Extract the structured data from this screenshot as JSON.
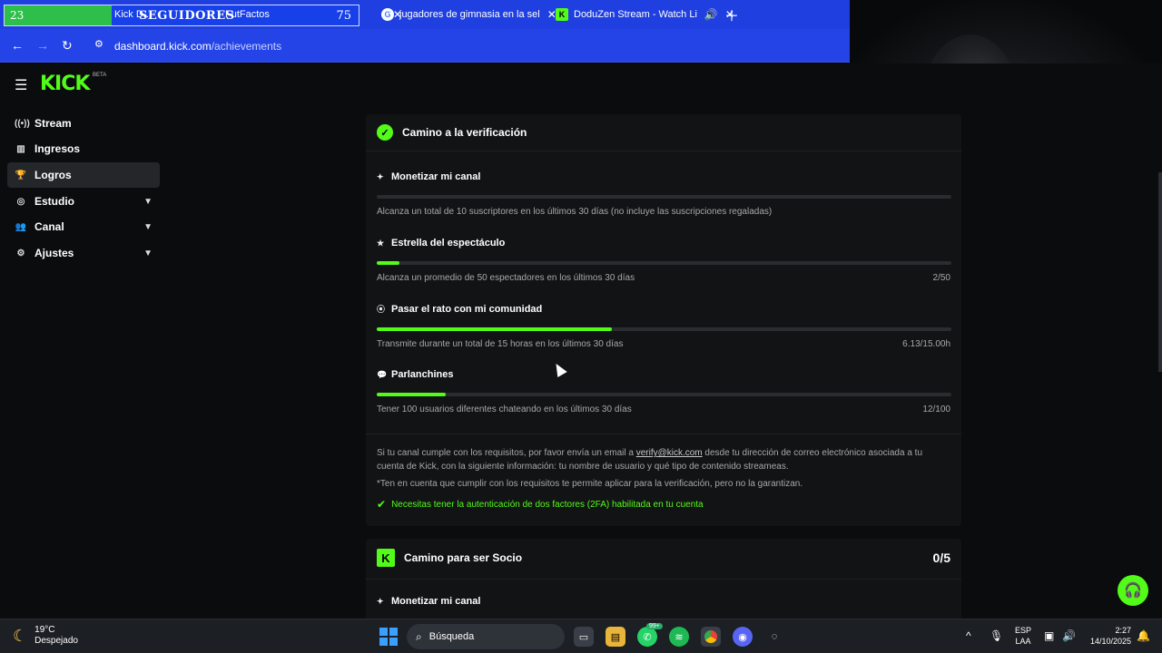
{
  "browser": {
    "overlay": {
      "left_value": "23",
      "title": "SEGUIDORES",
      "right_value": "75"
    },
    "tabs": [
      {
        "label": "Kick D...",
        "icon": "kick-icon"
      },
      {
        "label": "FutFactos",
        "icon": "page-icon"
      },
      {
        "label": "jugadores de gimnasia en la sel",
        "icon": "google-icon"
      },
      {
        "label": "DoduZen Stream - Watch Li",
        "icon": "kick-icon"
      }
    ],
    "url_host": "dashboard.kick.com",
    "url_path": "/achievements"
  },
  "app": {
    "logo": "KICK",
    "logo_badge": "BETA",
    "nav": [
      {
        "label": "Stream",
        "icon": "stream-icon",
        "active": false,
        "expandable": false
      },
      {
        "label": "Ingresos",
        "icon": "chart-icon",
        "active": false,
        "expandable": false
      },
      {
        "label": "Logros",
        "icon": "trophy-icon",
        "active": true,
        "expandable": false
      },
      {
        "label": "Estudio",
        "icon": "studio-icon",
        "active": false,
        "expandable": true
      },
      {
        "label": "Canal",
        "icon": "users-icon",
        "active": false,
        "expandable": true
      },
      {
        "label": "Ajustes",
        "icon": "gear-icon",
        "active": false,
        "expandable": true
      }
    ]
  },
  "verification": {
    "title": "Camino a la verificación",
    "tasks": [
      {
        "title": "Monetizar mi canal",
        "description": "Alcanza un total de 10 suscriptores en los últimos 30 días (no incluye las suscripciones regaladas)",
        "count": "",
        "progress": 0
      },
      {
        "title": "Estrella del espectáculo",
        "description": "Alcanza un promedio de 50 espectadores en los últimos 30 días",
        "count": "2/50",
        "progress": 0.04
      },
      {
        "title": "Pasar el rato con mi comunidad",
        "description": "Transmite durante un total de 15 horas en los últimos 30 días",
        "count": "6.13/15.00h",
        "progress": 0.409
      },
      {
        "title": "Parlanchines",
        "description": "Tener 100 usuarios diferentes chateando en los últimos 30 días",
        "count": "12/100",
        "progress": 0.12
      }
    ],
    "info_prefix": "Si tu canal cumple con los requisitos, por favor envía un email a ",
    "info_email": "verify@kick.com",
    "info_suffix": " desde tu dirección de correo electrónico asociada a tu cuenta de Kick, con la siguiente información: tu nombre de usuario y qué tipo de contenido streameas.",
    "note": "*Ten en cuenta que cumplir con los requisitos te permite aplicar para la verificación, pero no la garantizan.",
    "twofa": "Necesitas tener la autenticación de dos factores (2FA) habilitada en tu cuenta"
  },
  "partner": {
    "title": "Camino para ser Socio",
    "score": "0/5",
    "first_task": "Monetizar mi canal"
  },
  "taskbar": {
    "temp": "19°C",
    "weather": "Despejado",
    "search": "Búsqueda",
    "whatsapp_badge": "99+",
    "lang1": "ESP",
    "lang2": "LAA",
    "time": "2:27",
    "date": "14/10/2025"
  },
  "colors": {
    "accent": "#53fc18",
    "chrome": "#1f3fe0",
    "background": "#0b0c0d",
    "card": "#121315"
  }
}
